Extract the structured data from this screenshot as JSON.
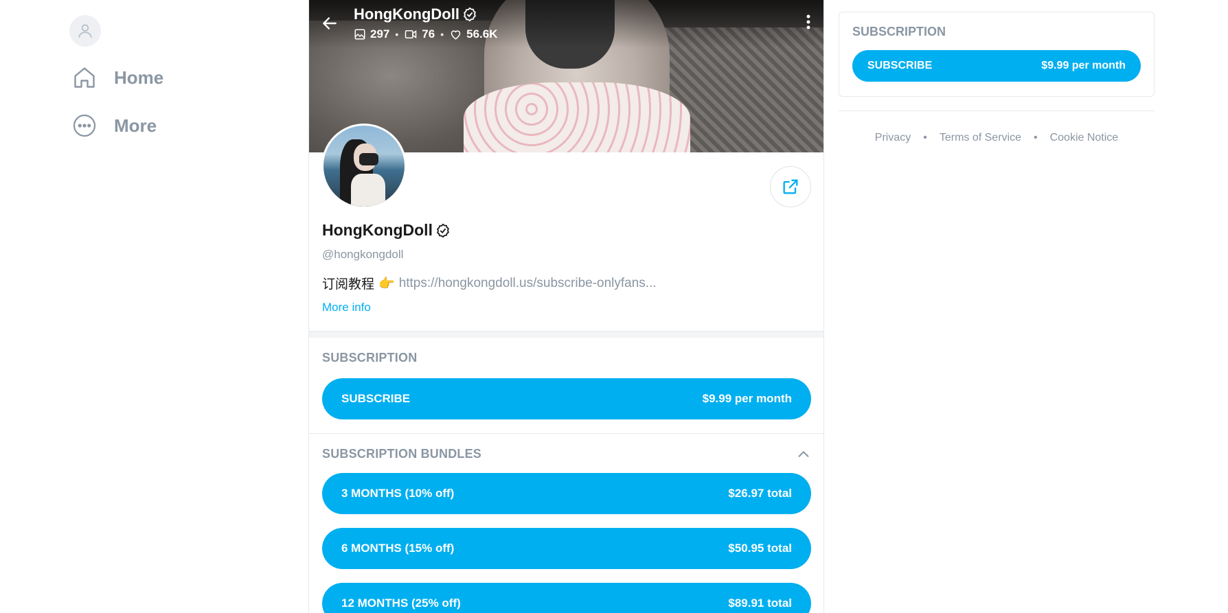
{
  "sidebar": {
    "items": [
      {
        "label": "Home",
        "icon": "home-icon"
      },
      {
        "label": "More",
        "icon": "more-icon"
      }
    ]
  },
  "cover": {
    "name": "HongKongDoll",
    "stats": {
      "photos": "297",
      "videos": "76",
      "likes": "56.6K"
    }
  },
  "profile": {
    "name": "HongKongDoll",
    "handle": "@hongkongdoll",
    "bio_text": "订阅教程",
    "bio_emoji": "👉",
    "bio_link": "https://hongkongdoll.us/subscribe-onlyfans...",
    "more_info": "More info"
  },
  "subscription": {
    "title": "SUBSCRIPTION",
    "button_label": "SUBSCRIBE",
    "button_price": "$9.99 per month"
  },
  "bundles": {
    "title": "SUBSCRIPTION BUNDLES",
    "items": [
      {
        "label": "3 MONTHS (10% off)",
        "price": "$26.97 total"
      },
      {
        "label": "6 MONTHS (15% off)",
        "price": "$50.95 total"
      },
      {
        "label": "12 MONTHS (25% off)",
        "price": "$89.91 total"
      }
    ]
  },
  "right_panel": {
    "title": "SUBSCRIPTION",
    "button_label": "SUBSCRIBE",
    "button_price": "$9.99 per month",
    "footer": [
      "Privacy",
      "Terms of Service",
      "Cookie Notice"
    ],
    "separator": "•"
  },
  "colors": {
    "accent": "#00aff0",
    "muted": "#8a96a3"
  }
}
